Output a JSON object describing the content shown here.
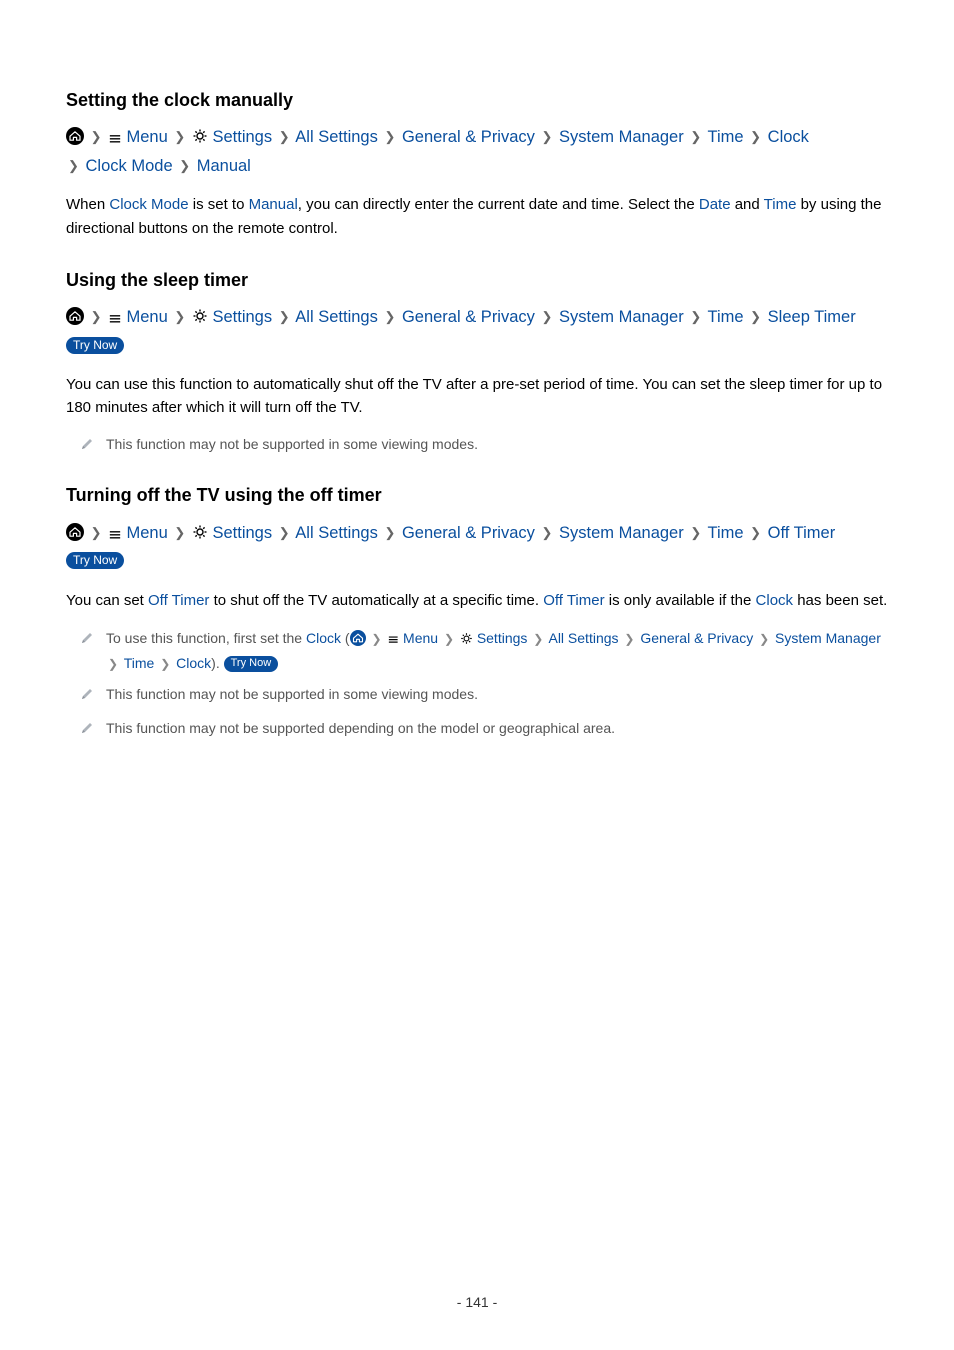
{
  "page_number": "- 141 -",
  "try_now_label": "Try Now",
  "nav_common": {
    "menu": "Menu",
    "settings": "Settings",
    "all_settings": "All Settings",
    "general_privacy": "General & Privacy",
    "system_manager": "System Manager",
    "time": "Time"
  },
  "section1": {
    "title": "Setting the clock manually",
    "nav_tail": {
      "clock": "Clock",
      "clock_mode": "Clock Mode",
      "manual": "Manual"
    },
    "body_pre": "When ",
    "body_hl1": "Clock Mode",
    "body_mid1": " is set to ",
    "body_hl2": "Manual",
    "body_mid2": ", you can directly enter the current date and time. Select the ",
    "body_hl3": "Date",
    "body_mid3": " and ",
    "body_hl4": "Time",
    "body_post": " by using the directional buttons on the remote control."
  },
  "section2": {
    "title": "Using the sleep timer",
    "nav_tail": "Sleep Timer",
    "body": "You can use this function to automatically shut off the TV after a pre-set period of time. You can set the sleep timer for up to 180 minutes after which it will turn off the TV.",
    "note1": "This function may not be supported in some viewing modes."
  },
  "section3": {
    "title": "Turning off the TV using the off timer",
    "nav_tail": "Off Timer",
    "body_pre": "You can set ",
    "body_hl1": "Off Timer",
    "body_mid1": " to shut off the TV automatically at a specific time. ",
    "body_hl2": "Off Timer",
    "body_mid2": " is only available if the ",
    "body_hl3": "Clock",
    "body_post": " has been set.",
    "note1_pre": "To use this function, first set the ",
    "note1_clock": "Clock",
    "note1_paren_sep": " (",
    "note1_path": {
      "menu": "Menu",
      "settings": "Settings",
      "all_settings": "All Settings",
      "general_privacy": "General & Privacy",
      "system_manager": "System Manager",
      "time": "Time",
      "clock": "Clock"
    },
    "note1_close": "). ",
    "note2": "This function may not be supported in some viewing modes.",
    "note3": "This function may not be supported depending on the model or geographical area."
  }
}
